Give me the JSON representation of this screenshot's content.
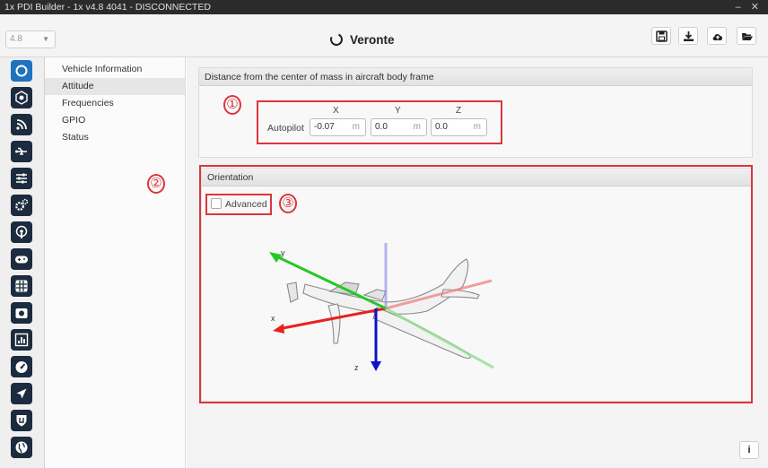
{
  "window": {
    "title": "1x PDI Builder - 1x v4.8 4041 - DISCONNECTED",
    "controls": "– ✕"
  },
  "header": {
    "version": "4.8",
    "brand": "Veronte",
    "toolbar": [
      "save-icon",
      "download-icon",
      "cloud-icon",
      "folder-open-icon"
    ]
  },
  "leftbar": {
    "icons": [
      "veronte-logo-icon",
      "vehicle-icon",
      "rss-icon",
      "usb-icon",
      "sliders-icon",
      "gears-icon",
      "podcast-icon",
      "gamepad-icon",
      "grid-icon",
      "camera-icon",
      "chart-icon",
      "gauge-icon",
      "plane-icon",
      "shield-icon",
      "globe-icon"
    ]
  },
  "subnav": {
    "items": [
      "Vehicle Information",
      "Attitude",
      "Frequencies",
      "GPIO",
      "Status"
    ],
    "selected": "Attitude"
  },
  "distance_panel": {
    "title": "Distance from the center of mass in aircraft body frame",
    "axes": [
      "X",
      "Y",
      "Z"
    ],
    "row_label": "Autopilot",
    "values": [
      "-0.07",
      "0.0",
      "0.0"
    ],
    "unit": "m"
  },
  "orientation_panel": {
    "title": "Orientation",
    "advanced_label": "Advanced",
    "advanced_checked": false,
    "axis_labels": {
      "x": "x",
      "y": "y",
      "z": "z"
    }
  },
  "callouts": [
    "①",
    "②",
    "③"
  ],
  "colors": {
    "highlight": "#d9363e",
    "active_icon": "#1e73be",
    "icon_bg": "#1c2b3d"
  }
}
